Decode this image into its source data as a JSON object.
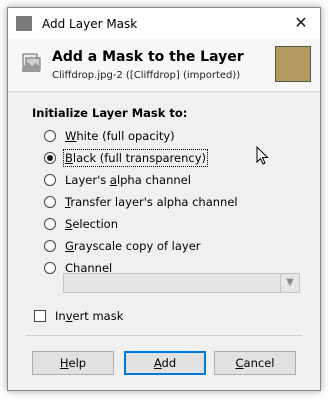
{
  "window": {
    "title": "Add Layer Mask"
  },
  "header": {
    "title": "Add a Mask to the Layer",
    "subtitle": "Cliffdrop.jpg-2 ([Cliffdrop] (imported))"
  },
  "form": {
    "section_title": "Initialize Layer Mask to:",
    "options": [
      {
        "mn": "W",
        "rest": "hite (full opacity)",
        "checked": false
      },
      {
        "mn": "B",
        "rest": "lack (full transparency)",
        "checked": true
      },
      {
        "pre": "Layer's ",
        "mn": "a",
        "rest": "lpha channel",
        "checked": false
      },
      {
        "mn": "T",
        "rest": "ransfer layer's alpha channel",
        "checked": false
      },
      {
        "mn": "S",
        "rest": "election",
        "checked": false
      },
      {
        "mn": "G",
        "rest": "rayscale copy of layer",
        "checked": false
      },
      {
        "mn": "C",
        "rest": "hannel",
        "checked": false
      }
    ],
    "channel_select_value": "",
    "invert": {
      "pre": "In",
      "mn": "v",
      "rest": "ert mask",
      "checked": false
    }
  },
  "buttons": {
    "help": {
      "mn": "H",
      "rest": "elp"
    },
    "add": {
      "mn": "A",
      "rest": "dd"
    },
    "cancel": {
      "mn": "C",
      "rest": "ancel"
    }
  },
  "colors": {
    "thumbnail": "#b39a5e",
    "focus_border": "#0078d7"
  }
}
